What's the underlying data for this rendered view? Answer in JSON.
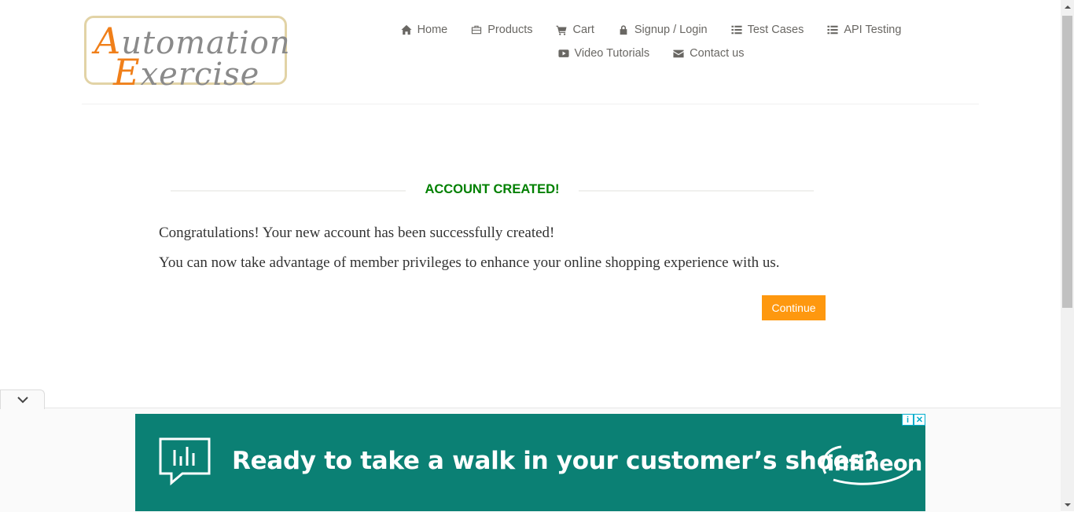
{
  "logo": {
    "line1_cap": "A",
    "line1_rest": "utomation",
    "line2_cap": "E",
    "line2_rest": "xercise"
  },
  "nav": {
    "row1": [
      {
        "label": "Home",
        "icon": "home-icon"
      },
      {
        "label": "Products",
        "icon": "products-icon"
      },
      {
        "label": "Cart",
        "icon": "cart-icon"
      },
      {
        "label": "Signup / Login",
        "icon": "lock-icon"
      },
      {
        "label": "Test Cases",
        "icon": "list-icon"
      },
      {
        "label": "API Testing",
        "icon": "list-icon"
      }
    ],
    "row2": [
      {
        "label": "Video Tutorials",
        "icon": "youtube-icon"
      },
      {
        "label": "Contact us",
        "icon": "envelope-icon"
      }
    ]
  },
  "content": {
    "title": "ACCOUNT CREATED!",
    "message1": "Congratulations! Your new account has been successfully created!",
    "message2": "You can now take advantage of member privileges to enhance your online shopping experience with us.",
    "continue_label": "Continue"
  },
  "ad": {
    "headline": "Ready to take a walk in your customer’s shoes?",
    "brand": "infineon",
    "info_glyph": "i",
    "close_glyph": "✕"
  },
  "colors": {
    "title_green": "#008000",
    "button_orange": "#fe980f",
    "ad_teal": "#0b8074",
    "logo_orange": "#f07f19"
  }
}
